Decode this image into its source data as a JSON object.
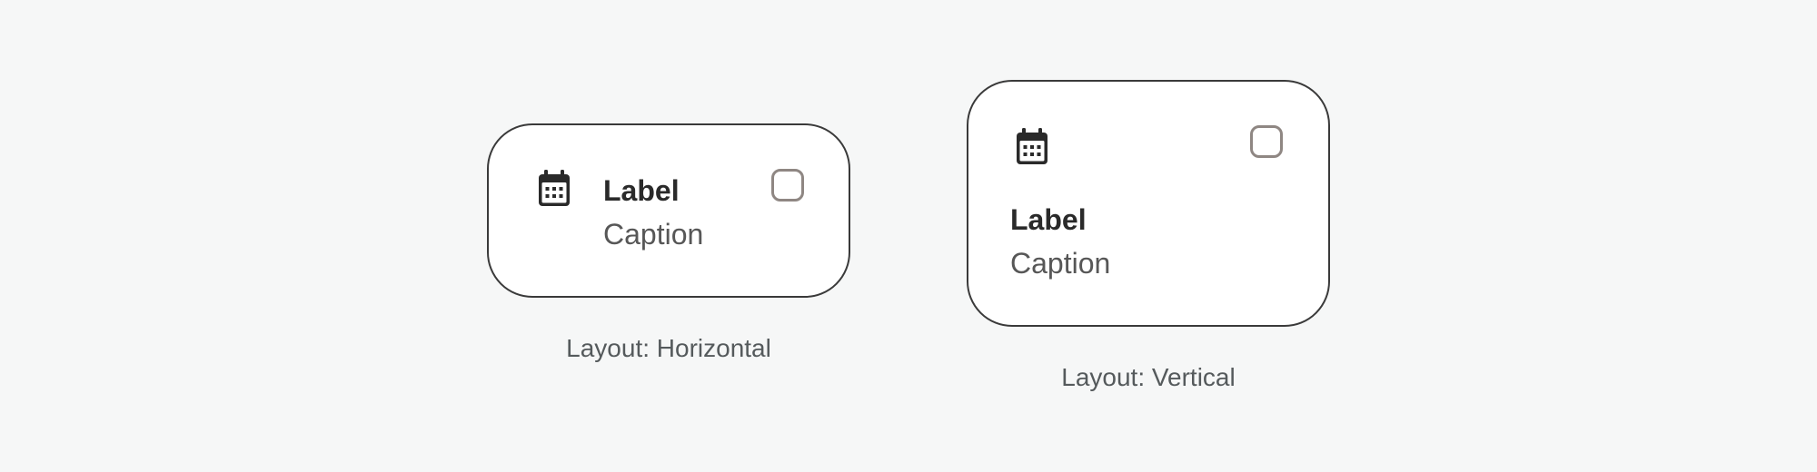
{
  "horizontal": {
    "label": "Label",
    "caption": "Caption",
    "icon": "calendar-icon",
    "checked": false,
    "layout_caption": "Layout: Horizontal"
  },
  "vertical": {
    "label": "Label",
    "caption": "Caption",
    "icon": "calendar-icon",
    "checked": false,
    "layout_caption": "Layout: Vertical"
  },
  "colors": {
    "background": "#f6f7f7",
    "card_border": "#3a3a3a",
    "checkbox_border": "#8f8783",
    "label_text": "#2a2a2a",
    "caption_text": "#575757"
  }
}
